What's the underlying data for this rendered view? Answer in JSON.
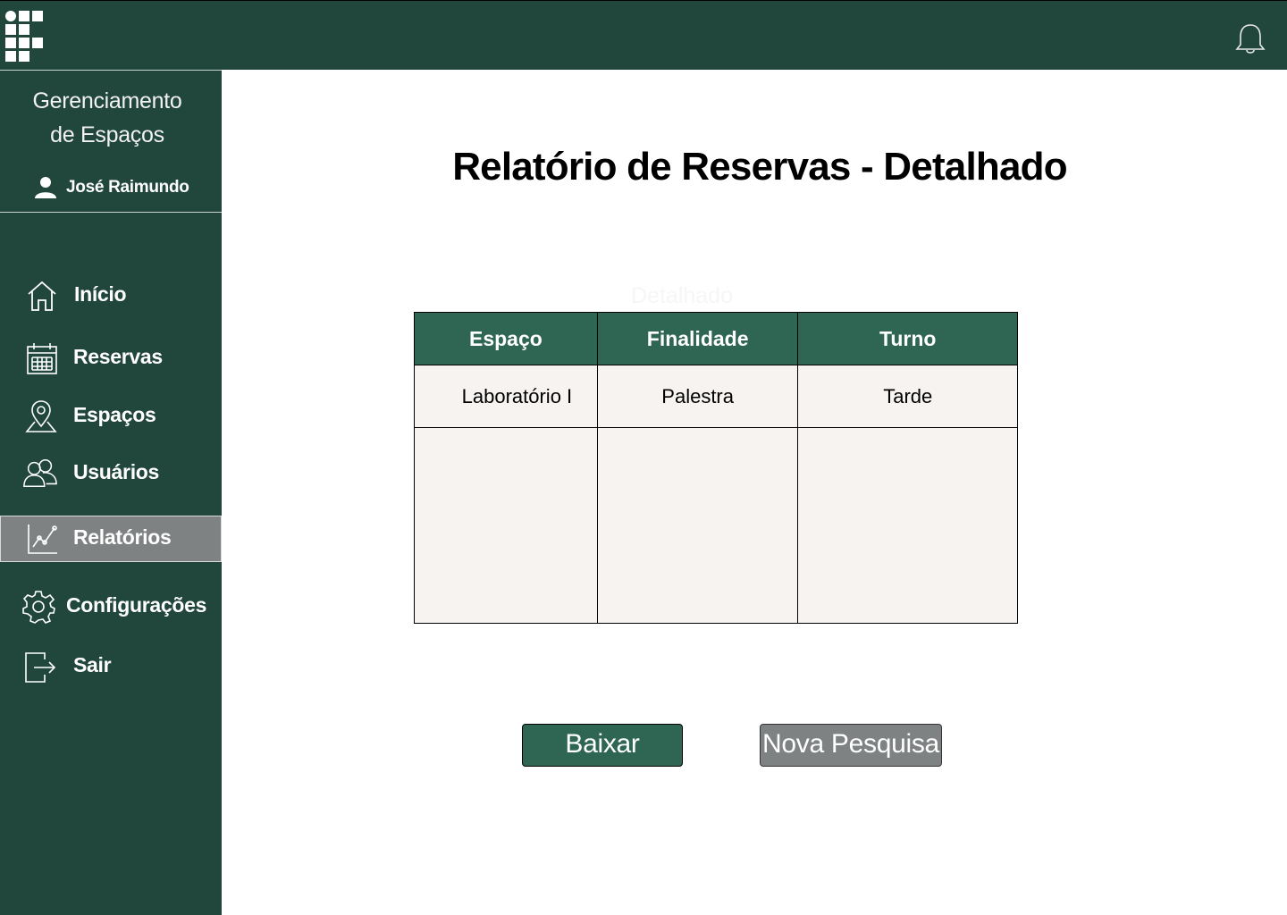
{
  "header": {
    "logo_icon": "institute-logo-icon",
    "notification_icon": "bell-icon"
  },
  "sidebar": {
    "app_title": "Gerenciamento\nde Espaços",
    "user": {
      "icon": "user-icon",
      "name": "José Raimundo"
    },
    "items": [
      {
        "label": "Início",
        "icon": "home-icon",
        "active": false
      },
      {
        "label": "Reservas",
        "icon": "calendar-icon",
        "active": false
      },
      {
        "label": "Espaços",
        "icon": "map-pin-icon",
        "active": false
      },
      {
        "label": "Usuários",
        "icon": "users-icon",
        "active": false
      },
      {
        "label": "Relatórios",
        "icon": "chart-icon",
        "active": true
      },
      {
        "label": "Configurações",
        "icon": "gear-icon",
        "active": false
      },
      {
        "label": "Sair",
        "icon": "logout-icon",
        "active": false
      }
    ]
  },
  "main": {
    "title": "Relatório de Reservas - Detalhado",
    "ghost_label": "Detalhado",
    "table": {
      "headers": [
        "Espaço",
        "Finalidade",
        "Turno"
      ],
      "rows": [
        [
          "Laboratório I",
          "Palestra",
          "Tarde"
        ]
      ]
    },
    "buttons": {
      "download": "Baixar",
      "new_search": "Nova Pesquisa"
    }
  },
  "colors": {
    "dark_green": "#21463b",
    "table_header_green": "#2e6653",
    "active_gray": "#7f8283",
    "table_body": "#f6f3f1"
  }
}
